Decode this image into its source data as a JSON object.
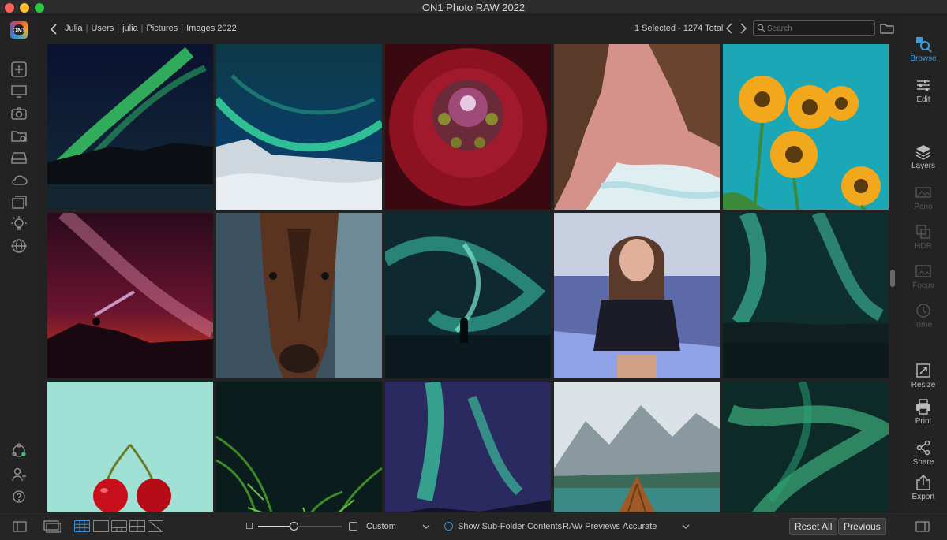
{
  "window": {
    "title": "ON1 Photo RAW 2022"
  },
  "app": {
    "logo_text": "ON1"
  },
  "breadcrumb": [
    "Julia",
    "Users",
    "julia",
    "Pictures",
    "Images 2022"
  ],
  "header": {
    "selection_status": "1 Selected - 1274 Total",
    "search_placeholder": "Search"
  },
  "left_tools": [
    {
      "name": "add-icon"
    },
    {
      "name": "display-icon"
    },
    {
      "name": "camera-icon"
    },
    {
      "name": "folder-icon"
    },
    {
      "name": "drive-icon"
    },
    {
      "name": "cloud-icon"
    },
    {
      "name": "albums-icon"
    },
    {
      "name": "bulb-icon"
    },
    {
      "name": "globe-icon"
    },
    {
      "name": "sync-icon"
    },
    {
      "name": "people-icon"
    },
    {
      "name": "help-icon"
    }
  ],
  "right_tools": [
    {
      "label": "Browse",
      "state": "active"
    },
    {
      "label": "Edit",
      "state": "normal"
    },
    {
      "label": "Layers",
      "state": "normal"
    },
    {
      "label": "Pano",
      "state": "disabled"
    },
    {
      "label": "HDR",
      "state": "disabled"
    },
    {
      "label": "Focus",
      "state": "disabled"
    },
    {
      "label": "Time",
      "state": "disabled"
    },
    {
      "label": "Resize",
      "state": "normal"
    },
    {
      "label": "Print",
      "state": "normal"
    },
    {
      "label": "Share",
      "state": "normal"
    },
    {
      "label": "Export",
      "state": "normal"
    }
  ],
  "photos": [
    {
      "subject": "aurora over mountains"
    },
    {
      "subject": "aurora over snowy coast"
    },
    {
      "subject": "red dahlia flower"
    },
    {
      "subject": "aerial beach and rocks"
    },
    {
      "subject": "sunflowers on teal"
    },
    {
      "subject": "milky way and headlamp"
    },
    {
      "subject": "horse portrait"
    },
    {
      "subject": "aurora with person"
    },
    {
      "subject": "woman in neon room"
    },
    {
      "subject": "aurora over lake"
    },
    {
      "subject": "cherries on mint"
    },
    {
      "subject": "palm fronds dark"
    },
    {
      "subject": "aurora curtains"
    },
    {
      "subject": "mountain lake with boat"
    },
    {
      "subject": "green aurora swirl"
    }
  ],
  "bottom": {
    "sort_option": "Custom",
    "subfolder_label": "Show Sub-Folder Contents",
    "raw_previews_label": "RAW Previews",
    "raw_previews_value": "Accurate",
    "reset_all": "Reset All",
    "previous": "Previous"
  },
  "colors": {
    "accent": "#3d9be0",
    "background": "#222222"
  }
}
